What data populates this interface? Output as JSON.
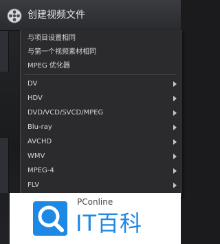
{
  "title_bar": {
    "title": "创建视频文件",
    "icon": "film-reel-icon"
  },
  "menu": {
    "items": [
      {
        "label": "与项目设置相同",
        "has_submenu": false
      },
      {
        "label": "与第一个视频素材相同",
        "has_submenu": false
      },
      {
        "label": "MPEG 优化器",
        "has_submenu": false
      },
      {
        "label": "DV",
        "has_submenu": true
      },
      {
        "label": "HDV",
        "has_submenu": true
      },
      {
        "label": "DVD/VCD/SVCD/MPEG",
        "has_submenu": true
      },
      {
        "label": "Blu-ray",
        "has_submenu": true
      },
      {
        "label": "AVCHD",
        "has_submenu": true
      },
      {
        "label": "WMV",
        "has_submenu": true
      },
      {
        "label": "MPEG-4",
        "has_submenu": true
      },
      {
        "label": "FLV",
        "has_submenu": true
      }
    ]
  },
  "watermark": {
    "brand": "PConline",
    "name": "IT百科",
    "logo_icon": "magnifier-logo-icon",
    "accent_color": "#1e88e5"
  }
}
